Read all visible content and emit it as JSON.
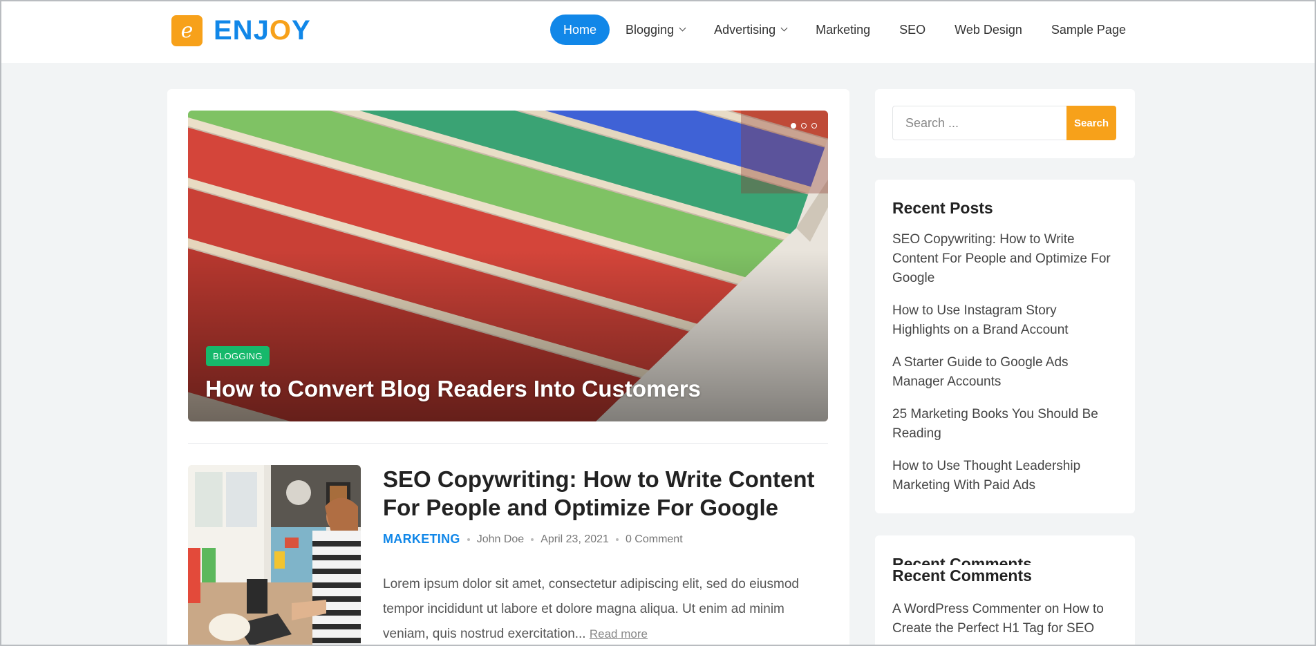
{
  "site": {
    "logo_letter": "e",
    "name_part1": "ENJ",
    "name_part2": "O",
    "name_part3": "Y",
    "brand_blue": "#1187e8",
    "brand_orange": "#f7a11a"
  },
  "nav": {
    "items": [
      {
        "label": "Home",
        "active": true
      },
      {
        "label": "Blogging",
        "dropdown": true
      },
      {
        "label": "Advertising",
        "dropdown": true
      },
      {
        "label": "Marketing"
      },
      {
        "label": "SEO"
      },
      {
        "label": "Web Design"
      },
      {
        "label": "Sample Page"
      }
    ]
  },
  "slider": {
    "badge": "BLOGGING",
    "title": "How to Convert Blog Readers Into Customers",
    "image": "colored-chalk-pastels-photo",
    "active_slide": 1,
    "slide_count": 3
  },
  "post": {
    "title": "SEO Copywriting: How to Write Content For People and Optimize For Google",
    "category": "MARKETING",
    "author": "John Doe",
    "date": "April 23, 2021",
    "comments": "0 Comment",
    "excerpt": "Lorem ipsum dolor sit amet, consectetur adipiscing elit, sed do eiusmod tempor incididunt ut labore et dolore magna aliqua. Ut enim ad minim veniam, quis nostrud exercitation...",
    "read_more": "Read more",
    "image": "woman-working-on-laptop-photo"
  },
  "sidebar": {
    "search": {
      "placeholder": "Search ...",
      "button": "Search"
    },
    "recent_posts": {
      "title": "Recent Posts",
      "items": [
        "SEO Copywriting: How to Write Content For People and Optimize For Google",
        "How to Use Instagram Story Highlights on a Brand Account",
        "A Starter Guide to Google Ads Manager Accounts",
        "25 Marketing Books You Should Be Reading",
        "How to Use Thought Leadership Marketing With Paid Ads"
      ]
    },
    "recent_comments": {
      "title": "Recent Comments",
      "items": [
        "A WordPress Commenter on How to Create the Perfect H1 Tag for SEO"
      ]
    }
  }
}
